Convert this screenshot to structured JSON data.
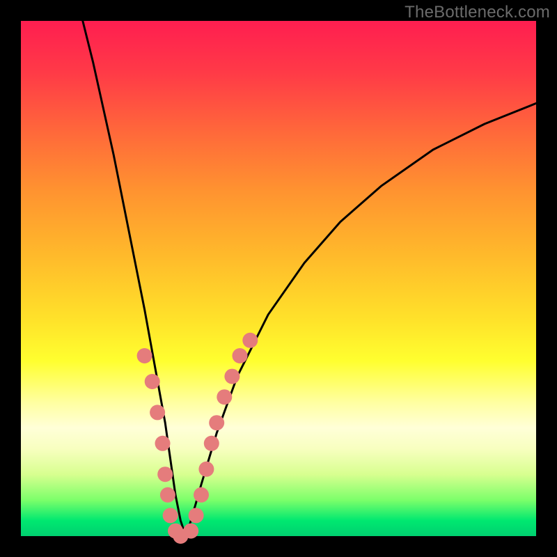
{
  "watermark": "TheBottleneck.com",
  "chart_data": {
    "type": "line",
    "title": "",
    "xlabel": "",
    "ylabel": "",
    "xlim": [
      0,
      100
    ],
    "ylim": [
      0,
      100
    ],
    "grid": false,
    "legend": false,
    "series": [
      {
        "name": "bottleneck-curve",
        "type": "line",
        "color": "#000000",
        "x": [
          12,
          14,
          16,
          18,
          20,
          22,
          24,
          26,
          28,
          29,
          30,
          31,
          32,
          33,
          35,
          38,
          42,
          48,
          55,
          62,
          70,
          80,
          90,
          100
        ],
        "y": [
          100,
          92,
          83,
          74,
          64,
          54,
          44,
          33,
          22,
          15,
          8,
          3,
          0,
          3,
          10,
          20,
          31,
          43,
          53,
          61,
          68,
          75,
          80,
          84
        ]
      },
      {
        "name": "dots-left",
        "type": "scatter",
        "color": "#e57c7c",
        "x": [
          24.0,
          25.5,
          26.5,
          27.5,
          28.0,
          28.5,
          29.0,
          30.0,
          31.0
        ],
        "y": [
          35,
          30,
          24,
          18,
          12,
          8,
          4,
          1,
          0
        ]
      },
      {
        "name": "dots-right",
        "type": "scatter",
        "color": "#e57c7c",
        "x": [
          33.0,
          34.0,
          35.0,
          36.0,
          37.0,
          38.0,
          39.5,
          41.0,
          42.5,
          44.5
        ],
        "y": [
          1,
          4,
          8,
          13,
          18,
          22,
          27,
          31,
          35,
          38
        ]
      }
    ]
  }
}
